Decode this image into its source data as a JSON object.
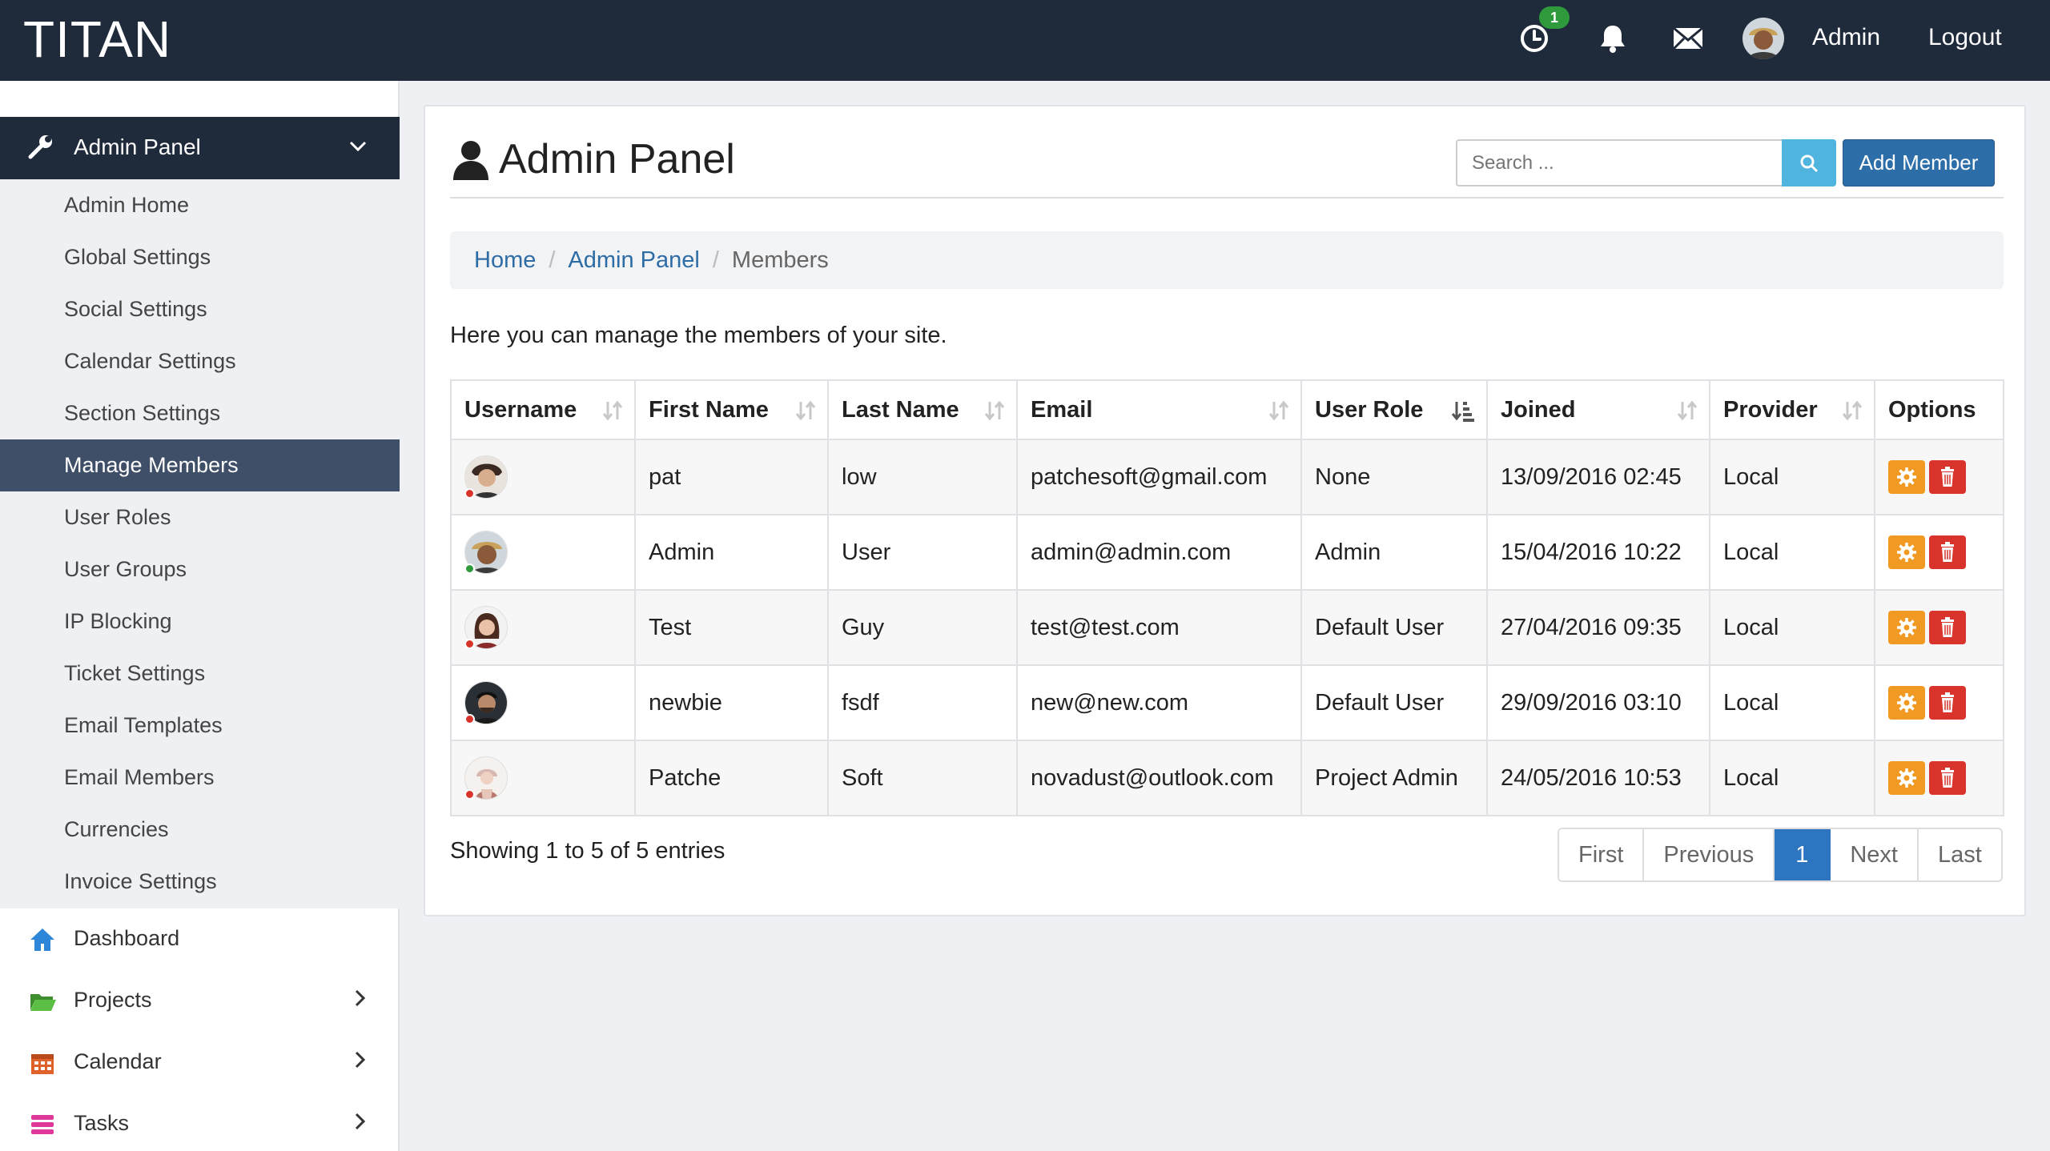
{
  "app": {
    "brand": "TITAN"
  },
  "topbar": {
    "notification_badge": "1",
    "user_label": "Admin",
    "logout_label": "Logout",
    "icons": [
      "clock-icon",
      "bell-icon",
      "mail-icon"
    ]
  },
  "sidebar": {
    "header": {
      "label": "Admin Panel",
      "icon": "wrench-icon"
    },
    "admin_items": [
      {
        "label": "Admin Home"
      },
      {
        "label": "Global Settings"
      },
      {
        "label": "Social Settings"
      },
      {
        "label": "Calendar Settings"
      },
      {
        "label": "Section Settings"
      },
      {
        "label": "Manage Members",
        "active": true
      },
      {
        "label": "User Roles"
      },
      {
        "label": "User Groups"
      },
      {
        "label": "IP Blocking"
      },
      {
        "label": "Ticket Settings"
      },
      {
        "label": "Email Templates"
      },
      {
        "label": "Email Members"
      },
      {
        "label": "Currencies"
      },
      {
        "label": "Invoice Settings"
      }
    ],
    "main_items": [
      {
        "label": "Dashboard",
        "icon": "home-icon",
        "color": "#2d86d8"
      },
      {
        "label": "Projects",
        "icon": "folder-icon",
        "color": "#4aa33b"
      },
      {
        "label": "Calendar",
        "icon": "calendar-icon",
        "color": "#e0622b"
      },
      {
        "label": "Tasks",
        "icon": "tasks-icon",
        "color": "#e0379b"
      }
    ]
  },
  "panel": {
    "title": "Admin Panel",
    "search_placeholder": "Search ...",
    "add_button": "Add Member",
    "breadcrumb": {
      "home": "Home",
      "section": "Admin Panel",
      "current": "Members"
    },
    "intro": "Here you can manage the members of your site.",
    "table": {
      "headers": [
        "Username",
        "First Name",
        "Last Name",
        "Email",
        "User Role",
        "Joined",
        "Provider",
        "Options"
      ],
      "rows": [
        {
          "first": "pat",
          "last": "low",
          "email": "patchesoft@gmail.com",
          "role": "None",
          "joined": "13/09/2016 02:45",
          "provider": "Local",
          "status": "offline"
        },
        {
          "first": "Admin",
          "last": "User",
          "email": "admin@admin.com",
          "role": "Admin",
          "joined": "15/04/2016 10:22",
          "provider": "Local",
          "status": "online"
        },
        {
          "first": "Test",
          "last": "Guy",
          "email": "test@test.com",
          "role": "Default User",
          "joined": "27/04/2016 09:35",
          "provider": "Local",
          "status": "offline"
        },
        {
          "first": "newbie",
          "last": "fsdf",
          "email": "new@new.com",
          "role": "Default User",
          "joined": "29/09/2016 03:10",
          "provider": "Local",
          "status": "offline"
        },
        {
          "first": "Patche",
          "last": "Soft",
          "email": "novadust@outlook.com",
          "role": "Project Admin",
          "joined": "24/05/2016 10:53",
          "provider": "Local",
          "status": "offline"
        }
      ]
    },
    "showing": "Showing 1 to 5 of 5 entries",
    "pagination": [
      "First",
      "Previous",
      "1",
      "Next",
      "Last"
    ],
    "current_page": "1"
  },
  "colors": {
    "topbar": "#1f2a3a",
    "primary": "#2d6ea8",
    "online": "#2e9a3c",
    "offline": "#d9342b",
    "gear": "#f19a23",
    "delete": "#d9342b"
  }
}
